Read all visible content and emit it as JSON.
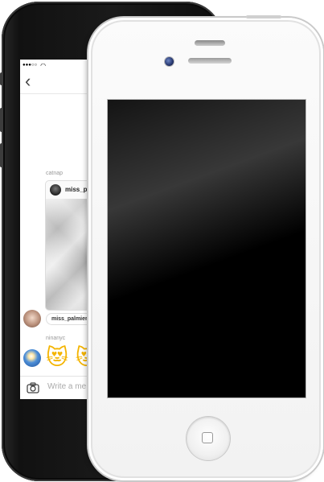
{
  "back_phone": {
    "chat": {
      "first_sender": "catnap",
      "shared_post_username": "miss_pa",
      "reply_username": "miss_palmieri",
      "second_sender": "ninanyc",
      "emoji_reaction": "😻 😻",
      "composer_placeholder": "Write a me"
    }
  },
  "front_phone": {
    "screen_state": "off"
  }
}
